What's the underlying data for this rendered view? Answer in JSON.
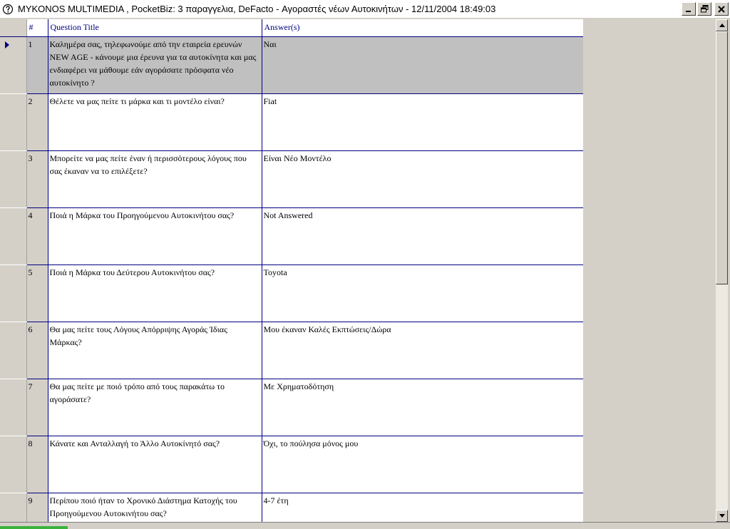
{
  "window": {
    "title": "MYKONOS MULTIMEDIA , PocketBiz: 3 παραγγελια, DeFacto - Αγοραστές νέων Αυτοκινήτων - 12/11/2004 18:49:03",
    "icon": "app-info-icon",
    "buttons": [
      "minimize-icon",
      "restore-icon",
      "close-icon"
    ]
  },
  "grid": {
    "columns": [
      "#",
      "Question Title",
      "Answer(s)"
    ],
    "rows": [
      {
        "num": "1",
        "question": "Καλημέρα σας, τηλεφωνούμε από την εταιρεία ερευνών NEW AGE - κάνουμε μια έρευνα για τα αυτοκίνητα και μας ενδιαφέρει να μάθουμε εάν αγοράσατε πρόσφατα νέο αυτοκίνητο ?",
        "answer": "Ναι"
      },
      {
        "num": "2",
        "question": "Θέλετε να μας πείτε τι μάρκα και τι μοντέλο είναι?",
        "answer": "Fiat"
      },
      {
        "num": "3",
        "question": "Μπορείτε να μας πείτε έναν ή περισσότερους λόγους που σας έκαναν να το επιλέξετε?",
        "answer": "Είναι Νέο Μοντέλο"
      },
      {
        "num": "4",
        "question": "Ποιά η Μάρκα του Προηγούμενου Αυτοκινήτου σας?",
        "answer": "Not Answered"
      },
      {
        "num": "5",
        "question": "Ποιά η Μάρκα του Δεύτερου Αυτοκινήτου σας?",
        "answer": "Toyota"
      },
      {
        "num": "6",
        "question": "Θα μας πείτε τους Λόγους Απόρριψης Αγοράς Ίδιας Μάρκας?",
        "answer": "Μου έκαναν Καλές Εκπτώσεις/Δώρα"
      },
      {
        "num": "7",
        "question": "Θα μας πείτε με ποιό τρόπο από τους παρακάτω το αγοράσατε?",
        "answer": "Με Χρηματοδότηση"
      },
      {
        "num": "8",
        "question": "Κάνατε και Ανταλλαγή το Άλλο Αυτοκίνητό σας?",
        "answer": "Όχι, το πούλησα μόνος μου"
      },
      {
        "num": "9",
        "question": "Περίπου ποιό ήταν το Χρονικό Διάστημα Κατοχής του Προηγούμενου Αυτοκινήτου σας?",
        "answer": "4-7 έτη"
      }
    ]
  },
  "colors": {
    "grid_line": "#000080",
    "selected_row": "#c0c0c0",
    "chrome": "#d4d0c8"
  }
}
